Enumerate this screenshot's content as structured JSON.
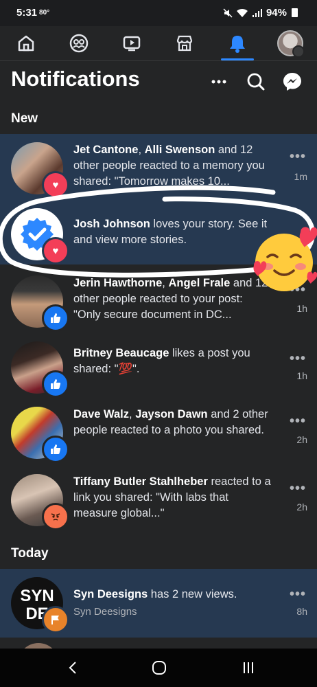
{
  "status_bar": {
    "time": "5:31",
    "temp": "80°",
    "battery": "94%"
  },
  "tabs": [
    {
      "name": "home",
      "icon": "home-icon"
    },
    {
      "name": "friends",
      "icon": "friends-icon"
    },
    {
      "name": "watch",
      "icon": "video-icon"
    },
    {
      "name": "marketplace",
      "icon": "marketplace-icon"
    },
    {
      "name": "notifications",
      "icon": "bell-icon",
      "active": true
    },
    {
      "name": "menu",
      "icon": "profile-avatar"
    }
  ],
  "header": {
    "title": "Notifications"
  },
  "sections": {
    "new": "New",
    "today": "Today"
  },
  "notifications": [
    {
      "pre": "",
      "name1": "Jet Cantone",
      "mid": ", ",
      "name2": "Alli Swenson",
      "rest": " and 12 other people reacted to a memory you shared: \"Tomorrow makes 10...",
      "time": "1m",
      "badge": "heart",
      "unread": true
    },
    {
      "pre": "",
      "name1": "Josh Johnson",
      "mid": "",
      "name2": "",
      "rest": " loves your story. See it and view more stories.",
      "time": "",
      "badge": "heart",
      "unread": true
    },
    {
      "pre": "",
      "name1": "Jerin Hawthorne",
      "mid": ", ",
      "name2": "Angel Frale",
      "rest": " and 12 other people reacted to your post: \"Only secure document in DC...",
      "time": "1h",
      "badge": "like",
      "unread": false
    },
    {
      "pre": "",
      "name1": "Britney Beaucage",
      "mid": "",
      "name2": "",
      "rest": " likes a post you shared: \"💯\".",
      "time": "1h",
      "badge": "like",
      "unread": false
    },
    {
      "pre": "",
      "name1": "Dave Walz",
      "mid": ", ",
      "name2": "Jayson Dawn",
      "rest": " and 2 other people reacted to a photo you shared.",
      "time": "2h",
      "badge": "like",
      "unread": false
    },
    {
      "pre": "",
      "name1": "Tiffany Butler Stahlheber",
      "mid": "",
      "name2": "",
      "rest": " reacted to a link you shared: \"With labs that measure global...\"",
      "time": "2h",
      "badge": "angry",
      "unread": false
    },
    {
      "pre": "",
      "name1": "Syn Deesigns",
      "mid": "",
      "name2": "",
      "rest": " has 2 new views.",
      "sub": "Syn Deesigns",
      "time": "8h",
      "badge": "flag",
      "unread": true
    }
  ],
  "colors": {
    "accent": "#2d88ff",
    "unread_bg": "#263951",
    "bg": "#242526",
    "heart": "#f33e58",
    "like": "#1877f2",
    "angry": "#f7714c"
  }
}
